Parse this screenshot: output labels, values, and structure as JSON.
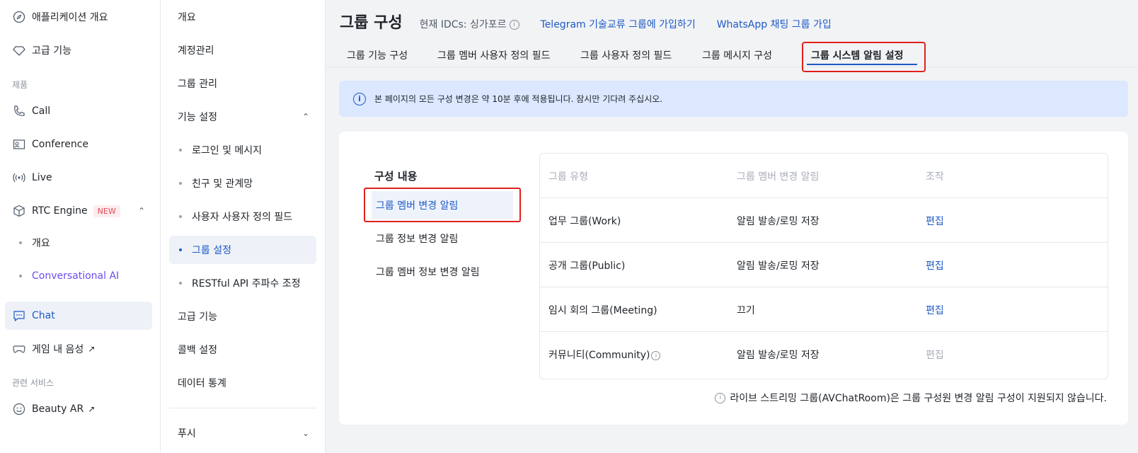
{
  "sidebar1": {
    "items": [
      {
        "label": "애플리케이션 개요",
        "icon": "compass-icon"
      },
      {
        "label": "고급 기능",
        "icon": "diamond-icon"
      }
    ],
    "section_products": "제품",
    "products": [
      {
        "label": "Call",
        "icon": "phone-icon"
      },
      {
        "label": "Conference",
        "icon": "conference-icon"
      },
      {
        "label": "Live",
        "icon": "broadcast-icon"
      },
      {
        "label": "RTC Engine",
        "icon": "cube-icon",
        "badge": "NEW"
      }
    ],
    "rtc_sub": [
      "개요",
      "Conversational AI"
    ],
    "chat": {
      "label": "Chat",
      "icon": "chat-icon"
    },
    "game": {
      "label": "게임 내 음성",
      "icon": "gamepad-icon"
    },
    "section_related": "관련 서비스",
    "beauty": {
      "label": "Beauty AR",
      "icon": "smile-icon"
    }
  },
  "sidebar2": {
    "items": [
      "개요",
      "계정관리",
      "그룹 관리",
      "기능 설정"
    ],
    "sub": [
      "로그인 및 메시지",
      "친구 및 관계망",
      "사용자 사용자 정의 필드",
      "그룹 설정",
      "RESTful API 주파수 조정"
    ],
    "after": [
      "고급 기능",
      "콜백 설정",
      "데이터 통계"
    ],
    "push": "푸시"
  },
  "header": {
    "title": "그룹 구성",
    "idc": "현재 IDCs: 싱가포르",
    "telegram_link": "Telegram 기술교류 그룹에 가입하기",
    "whatsapp_link": "WhatsApp 채팅 그룹 가입"
  },
  "tabs": [
    "그룹 기능 구성",
    "그룹 멤버 사용자 정의 필드",
    "그룹 사용자 정의 필드",
    "그룹 메시지 구성",
    "그룹 시스템 알림 설정"
  ],
  "notice": "본 페이지의 모든 구성 변경은 약 10분 후에 적용됩니다. 잠시만 기다려 주십시오.",
  "config": {
    "title": "구성 내용",
    "items": [
      "그룹 멤버 변경 알림",
      "그룹 정보 변경 알림",
      "그룹 멤버 정보 변경 알림"
    ]
  },
  "table": {
    "headers": [
      "그룹 유형",
      "그룹 멤버 변경 알림",
      "조작"
    ],
    "rows": [
      {
        "type": "업무 그룹(Work)",
        "notify": "알림 발송/로밍 저장",
        "action": "편집"
      },
      {
        "type": "공개 그룹(Public)",
        "notify": "알림 발송/로밍 저장",
        "action": "편집"
      },
      {
        "type": "임시 회의 그룹(Meeting)",
        "notify": "끄기",
        "action": "편집"
      },
      {
        "type": "커뮤니티(Community)",
        "notify": "알림 발송/로밍 저장",
        "action": "편집"
      }
    ]
  },
  "footnote": "라이브 스트리밍 그룹(AVChatRoom)은 그룹 구성원 변경 알림 구성이 지원되지 않습니다.",
  "colors": {
    "accent": "#1d59c6",
    "highlight": "#e0201b",
    "notice_bg": "#dbe8ff"
  }
}
